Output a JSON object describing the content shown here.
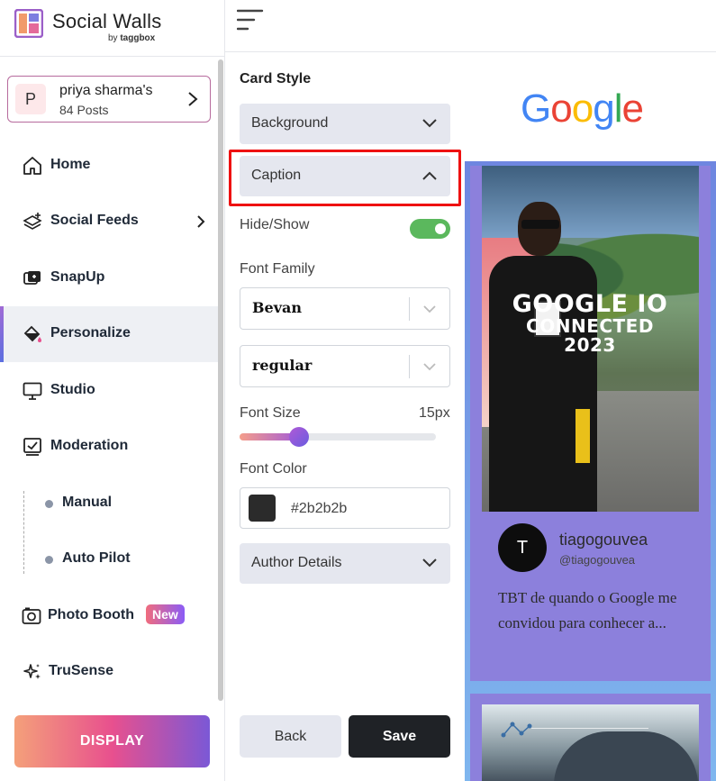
{
  "brand": {
    "title": "Social Walls",
    "by": "by",
    "by_brand": "taggbox"
  },
  "account": {
    "initial": "P",
    "name": "priya sharma's",
    "posts": "84 Posts"
  },
  "nav": {
    "home": "Home",
    "social_feeds": "Social Feeds",
    "snapup": "SnapUp",
    "personalize": "Personalize",
    "studio": "Studio",
    "moderation": "Moderation",
    "manual": "Manual",
    "auto_pilot": "Auto Pilot",
    "photo_booth": "Photo Booth",
    "photo_booth_badge": "New",
    "trusense": "TruSense",
    "active": "Personalize"
  },
  "display_button": "DISPLAY",
  "panel": {
    "title": "Card Style",
    "background": "Background",
    "caption": "Caption",
    "hide_show": "Hide/Show",
    "hide_show_enabled": true,
    "font_family_label": "Font Family",
    "font_family": "Bevan",
    "font_weight": "regular",
    "font_size_label": "Font Size",
    "font_size": "15px",
    "font_size_slider_fraction": 0.25,
    "font_color_label": "Font Color",
    "font_color": "#2b2b2b",
    "author_details": "Author Details",
    "back": "Back",
    "save": "Save"
  },
  "preview": {
    "logo_letters": [
      "G",
      "o",
      "o",
      "g",
      "l",
      "e"
    ],
    "logo_colors": [
      "#4285F4",
      "#EA4335",
      "#FBBC05",
      "#4285F4",
      "#34A853",
      "#EA4335"
    ],
    "post": {
      "image_title_line1": "GOOGLE IO",
      "image_title_line2": "CONNECTED 2023",
      "author_initial": "T",
      "author_name": "tiagogouvea",
      "author_handle": "@tiagogouvea",
      "caption": "TBT de quando o Google me convidou para conhecer a..."
    }
  },
  "colors": {
    "accent_toggle": "#5bb85d",
    "card_bg": "#8c80dc",
    "highlight": "#ee1111"
  }
}
